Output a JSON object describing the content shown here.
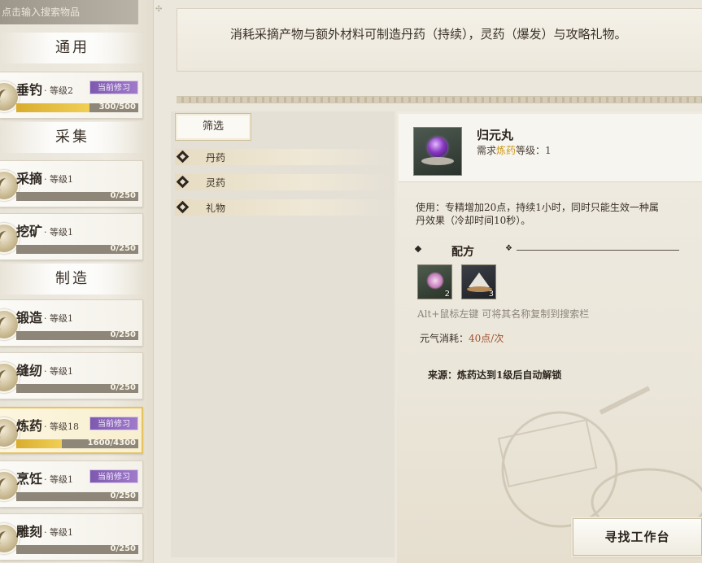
{
  "search": {
    "placeholder": "点击输入搜索物品"
  },
  "categories": {
    "general": "通用",
    "gather": "采集",
    "craft": "制造"
  },
  "skills": [
    {
      "name": "垂钓",
      "level": "· 等级2",
      "tag": "当前修习",
      "progress": "300/500",
      "fill": 0.6
    },
    {
      "name": "采摘",
      "level": "· 等级1",
      "tag": "",
      "progress": "0/250",
      "fill": 0
    },
    {
      "name": "挖矿",
      "level": "· 等级1",
      "tag": "",
      "progress": "0/250",
      "fill": 0
    },
    {
      "name": "锻造",
      "level": "· 等级1",
      "tag": "",
      "progress": "0/250",
      "fill": 0
    },
    {
      "name": "缝纫",
      "level": "· 等级1",
      "tag": "",
      "progress": "0/250",
      "fill": 0
    },
    {
      "name": "炼药",
      "level": "· 等级18",
      "tag": "当前修习",
      "progress": "1600/4300",
      "fill": 0.372
    },
    {
      "name": "烹饪",
      "level": "· 等级1",
      "tag": "当前修习",
      "progress": "0/250",
      "fill": 0
    },
    {
      "name": "雕刻",
      "level": "· 等级1",
      "tag": "",
      "progress": "0/250",
      "fill": 0
    }
  ],
  "banner": {
    "text": "消耗采摘产物与额外材料可制造丹药（持续），灵药（爆发）与攻略礼物。"
  },
  "filter": {
    "tab_label": "筛选",
    "items": [
      "丹药",
      "灵药",
      "礼物"
    ]
  },
  "item": {
    "name": "归元丸",
    "req_prefix": "需求",
    "req_skill": "炼药",
    "req_suffix": "等级：1",
    "usage_line1": "使用：专精增加20点，持续1小时，同时只能生效一种属",
    "usage_line2": "丹效果（冷却时间10秒）。",
    "recipe_title": "配方",
    "materials": [
      {
        "icon": "flower-icon",
        "qty": "2"
      },
      {
        "icon": "salt-pile-icon",
        "qty": "3"
      }
    ],
    "hint": "Alt+鼠标左键 可将其名称复制到搜索栏",
    "cost_label": "元气消耗：",
    "cost_value": "40点/次",
    "source": "来源：炼药达到1级后自动解锁"
  },
  "find_button": "寻找工作台"
}
